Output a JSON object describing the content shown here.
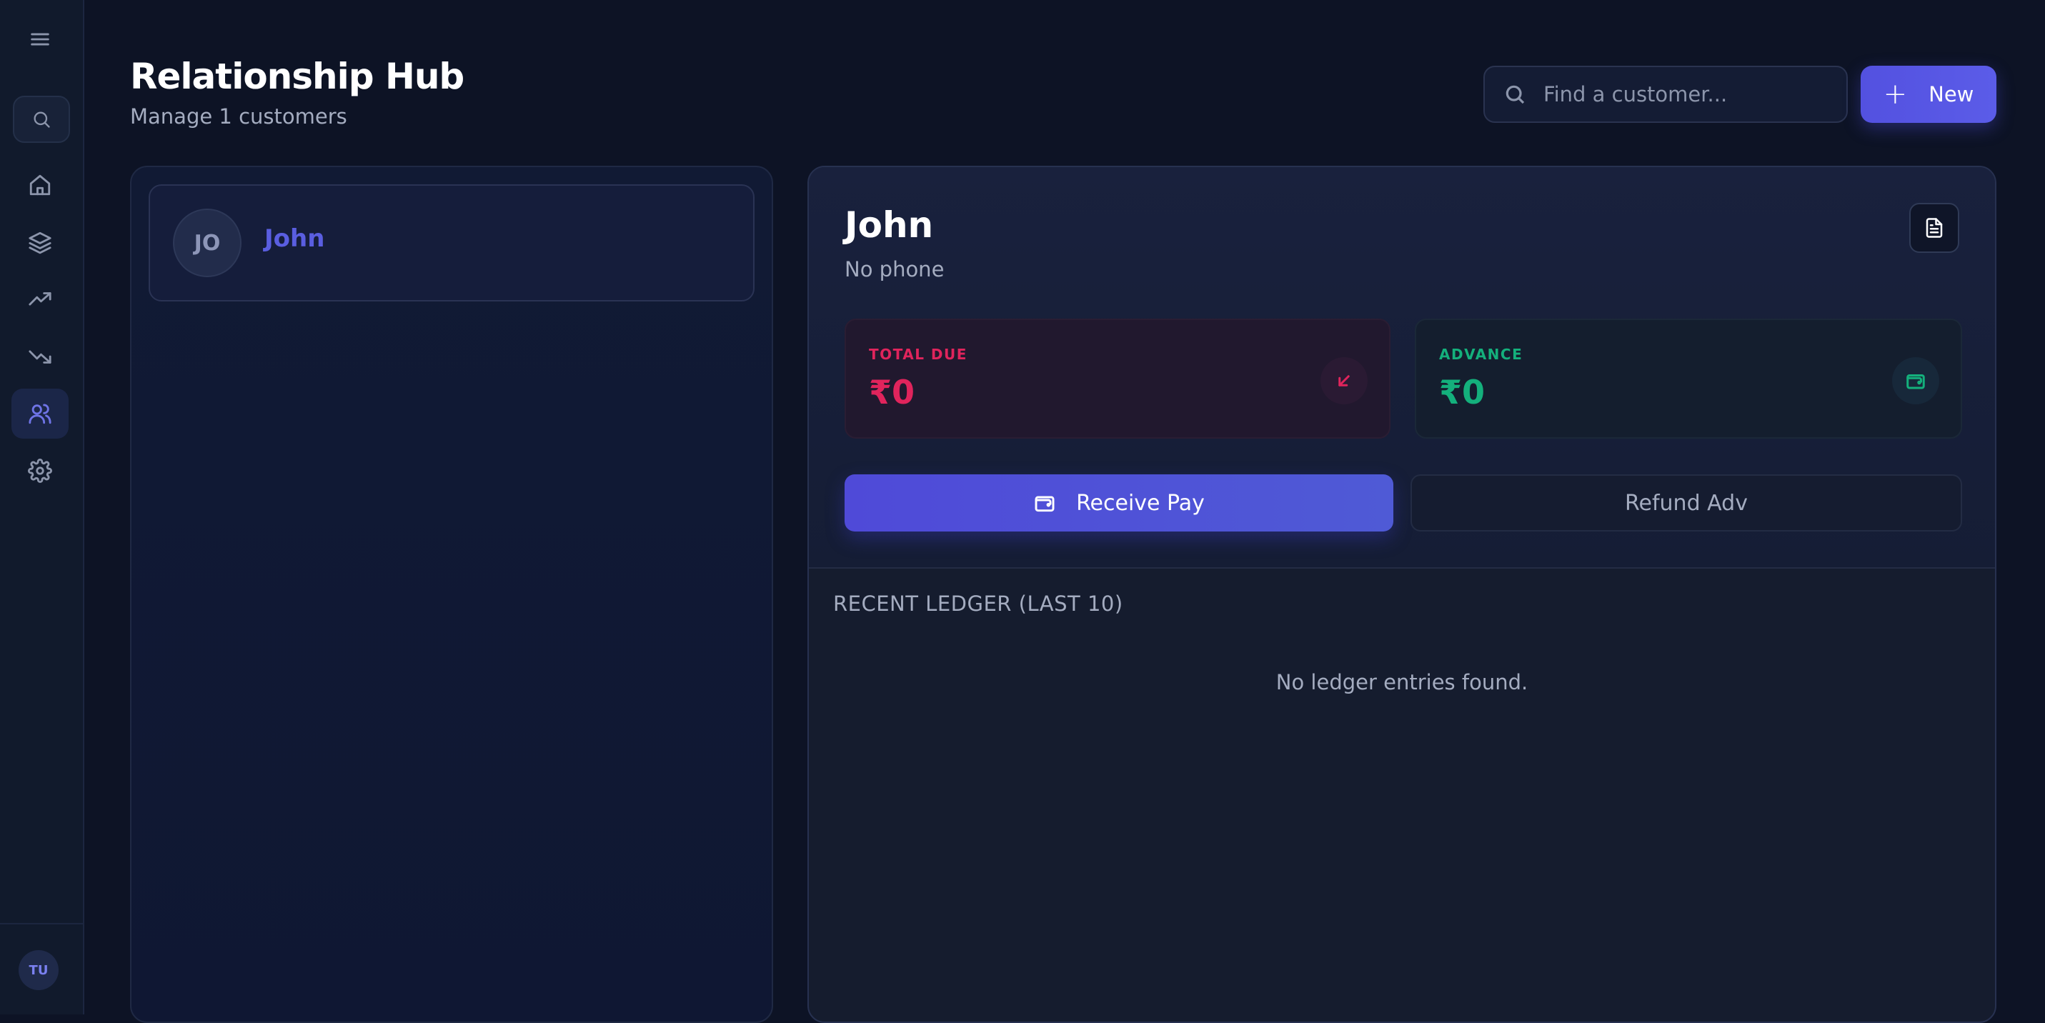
{
  "sidebar": {
    "avatar_initials": "TU",
    "active_item": "customers",
    "items": [
      {
        "key": "menu",
        "icon": "menu-icon"
      },
      {
        "key": "search",
        "icon": "search-icon"
      },
      {
        "key": "home",
        "icon": "home-icon"
      },
      {
        "key": "inventory",
        "icon": "layers-icon"
      },
      {
        "key": "income",
        "icon": "trending-up-icon"
      },
      {
        "key": "expenses",
        "icon": "trending-down-icon"
      },
      {
        "key": "customers",
        "icon": "users-icon"
      },
      {
        "key": "settings",
        "icon": "gear-icon"
      }
    ]
  },
  "header": {
    "title": "Relationship Hub",
    "subtitle": "Manage 1 customers",
    "search_placeholder": "Find a customer...",
    "new_button_label": "New"
  },
  "customer_list": [
    {
      "initials": "JO",
      "name": "John"
    }
  ],
  "detail": {
    "name": "John",
    "phone": "No phone",
    "total_due_label": "TOTAL DUE",
    "total_due_value": "₹0",
    "advance_label": "ADVANCE",
    "advance_value": "₹0",
    "receive_button_label": "Receive Pay",
    "refund_button_label": "Refund Adv",
    "ledger_title": "RECENT LEDGER (LAST 10)",
    "ledger_empty_text": "No ledger entries found."
  },
  "colors": {
    "accent": "#5351e0",
    "due": "#e0245c",
    "advance": "#14b07c",
    "background": "#0d1325"
  }
}
